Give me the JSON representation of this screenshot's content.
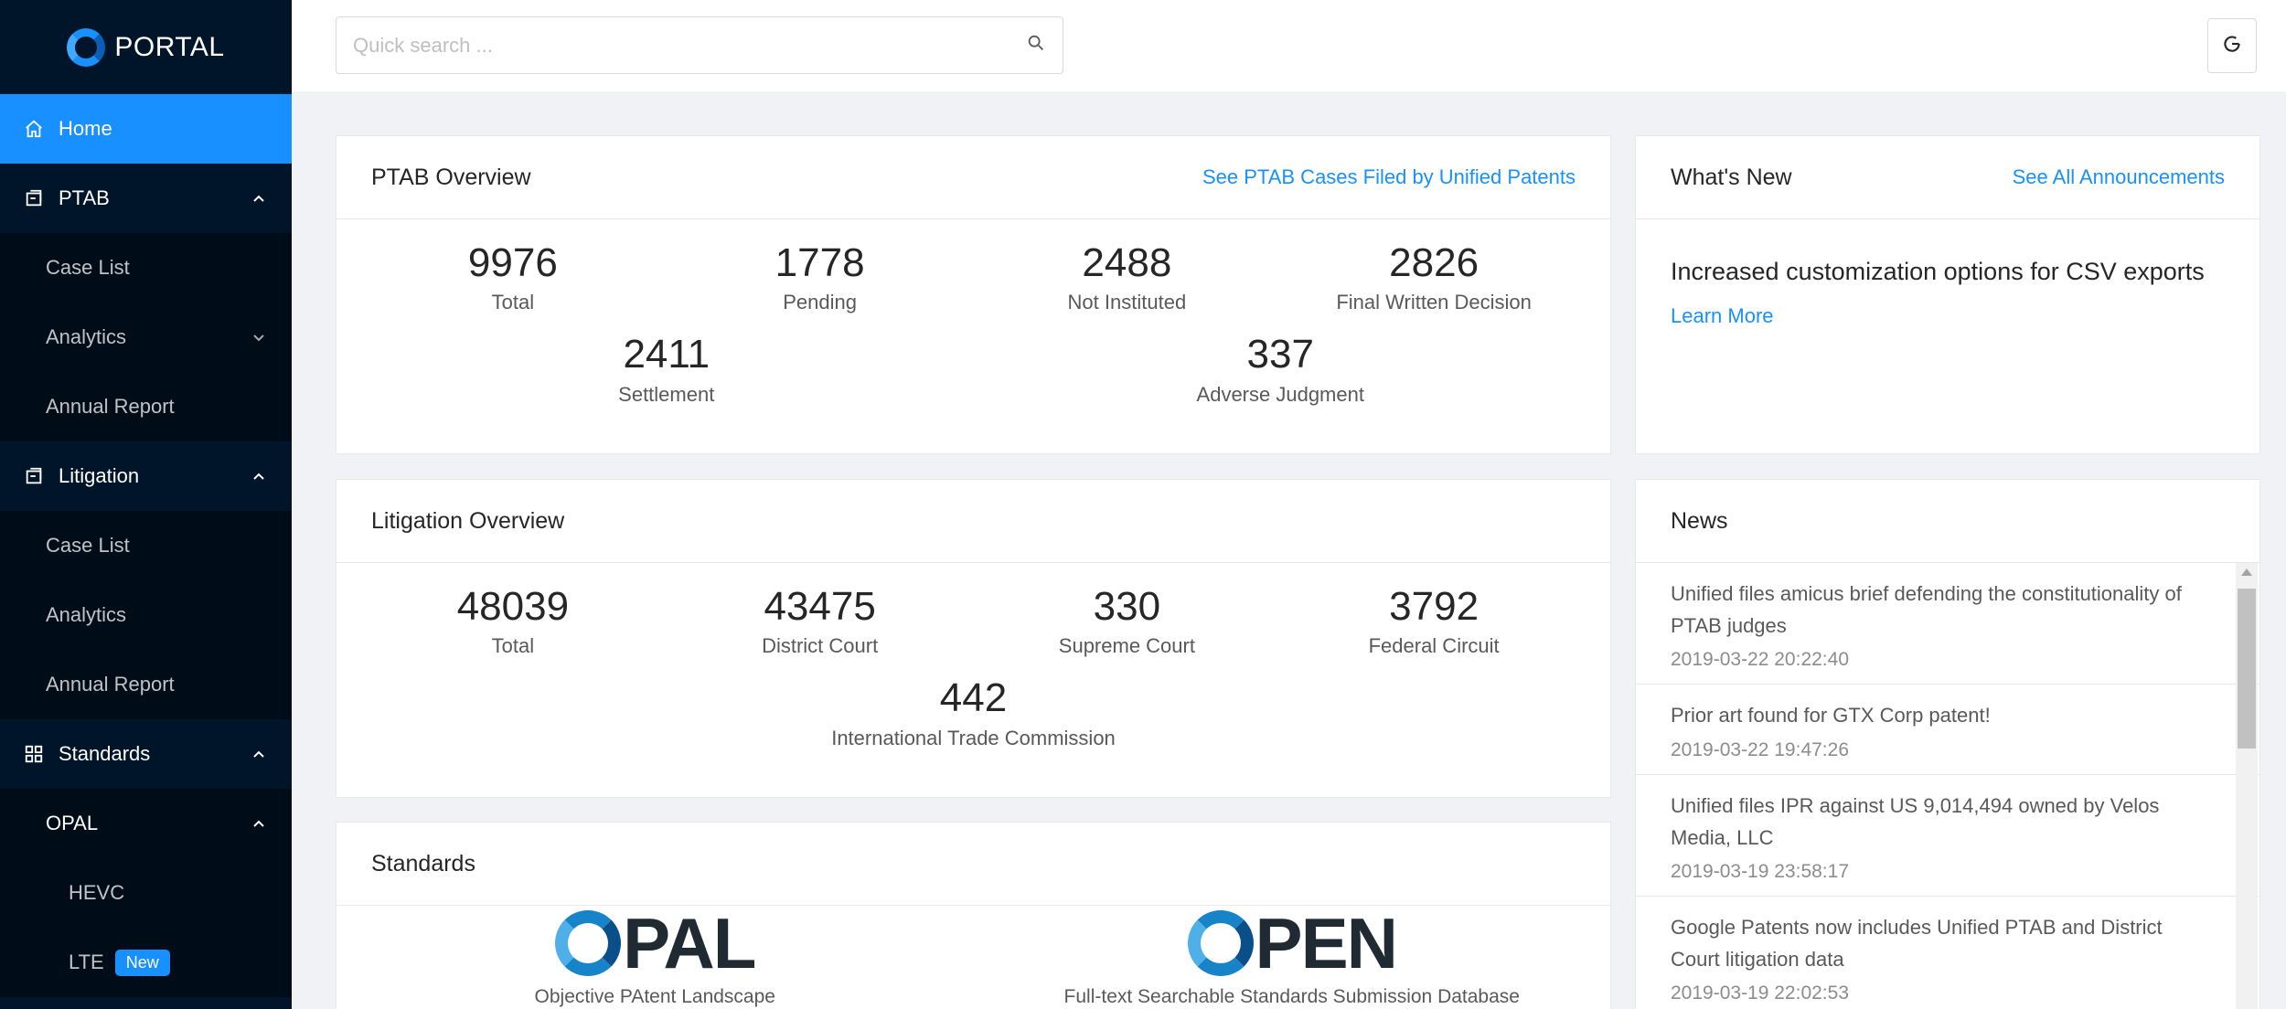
{
  "app": {
    "name": "PORTAL"
  },
  "sidebar": {
    "items": [
      {
        "label": "Home"
      },
      {
        "label": "PTAB"
      },
      {
        "label": "Case List"
      },
      {
        "label": "Analytics"
      },
      {
        "label": "Annual Report"
      },
      {
        "label": "Litigation"
      },
      {
        "label": "Case List"
      },
      {
        "label": "Analytics"
      },
      {
        "label": "Annual Report"
      },
      {
        "label": "Standards"
      },
      {
        "label": "OPAL"
      },
      {
        "label": "HEVC"
      },
      {
        "label": "LTE",
        "badge": "New"
      }
    ]
  },
  "search": {
    "placeholder": "Quick search ..."
  },
  "ptab": {
    "title": "PTAB Overview",
    "link": "See PTAB Cases Filed by Unified Patents",
    "stats": [
      {
        "value": "9976",
        "label": "Total"
      },
      {
        "value": "1778",
        "label": "Pending"
      },
      {
        "value": "2488",
        "label": "Not Instituted"
      },
      {
        "value": "2826",
        "label": "Final Written Decision"
      },
      {
        "value": "2411",
        "label": "Settlement"
      },
      {
        "value": "337",
        "label": "Adverse Judgment"
      }
    ]
  },
  "litigation": {
    "title": "Litigation Overview",
    "stats": [
      {
        "value": "48039",
        "label": "Total"
      },
      {
        "value": "43475",
        "label": "District Court"
      },
      {
        "value": "330",
        "label": "Supreme Court"
      },
      {
        "value": "3792",
        "label": "Federal Circuit"
      },
      {
        "value": "442",
        "label": "International Trade Commission"
      }
    ]
  },
  "standards": {
    "title": "Standards",
    "items": [
      {
        "logo": "OPAL",
        "logo_rest": "PAL",
        "caption": "Objective PAtent Landscape"
      },
      {
        "logo": "OPEN",
        "logo_rest": "PEN",
        "caption": "Full-text Searchable Standards Submission Database"
      }
    ]
  },
  "whats_new": {
    "title": "What's New",
    "link": "See All Announcements",
    "headline": "Increased customization options for CSV exports",
    "learn_more": "Learn More"
  },
  "news": {
    "title": "News",
    "items": [
      {
        "title": "Unified files amicus brief defending the constitutionality of PTAB judges",
        "date": "2019-03-22 20:22:40"
      },
      {
        "title": "Prior art found for GTX Corp patent!",
        "date": "2019-03-22 19:47:26"
      },
      {
        "title": "Unified files IPR against US 9,014,494 owned by Velos Media, LLC",
        "date": "2019-03-19 23:58:17"
      },
      {
        "title": "Google Patents now includes Unified PTAB and District Court litigation data",
        "date": "2019-03-19 22:02:53"
      }
    ]
  },
  "colors": {
    "accent": "#1890ff",
    "sidebar_bg": "#001529",
    "submenu_bg": "#000c17"
  },
  "icons": [
    "home-icon",
    "ptab-icon",
    "litigation-icon",
    "standards-icon",
    "search-icon",
    "refresh-icon"
  ]
}
